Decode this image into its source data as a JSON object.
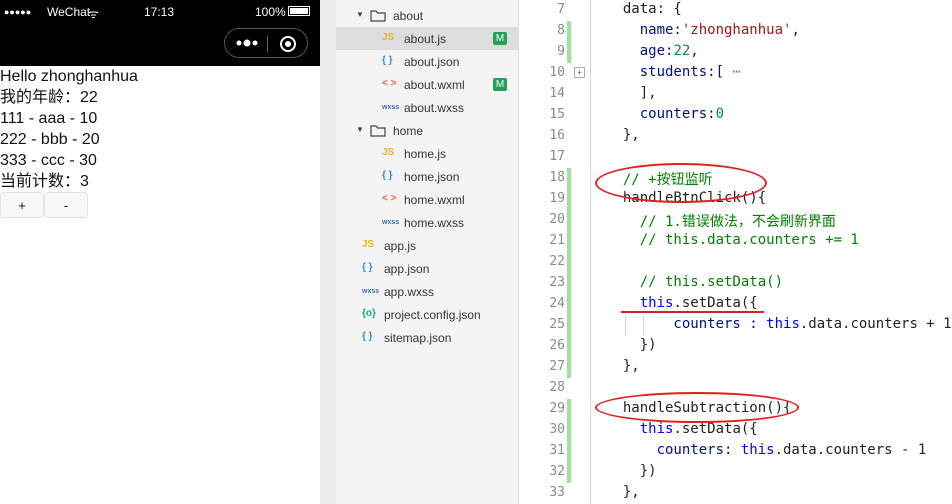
{
  "simulator": {
    "signal": "●●●●●",
    "carrier": "WeChat",
    "wifi": "ᯤ",
    "time": "17:13",
    "battery_pct": "100%",
    "lines": [
      "Hello zhonghanhua",
      "我的年龄：22",
      "111 - aaa - 10",
      "222 - bbb - 20",
      "333 - ccc - 30",
      "当前计数：3"
    ],
    "buttons": [
      "+",
      "-"
    ]
  },
  "file_tree": [
    {
      "name": "about",
      "type": "folder",
      "depth": 0
    },
    {
      "name": "about.js",
      "type": "js",
      "depth": 1,
      "selected": true,
      "badge": "M"
    },
    {
      "name": "about.json",
      "type": "json",
      "depth": 1
    },
    {
      "name": "about.wxml",
      "type": "wxml",
      "depth": 1,
      "badge": "M"
    },
    {
      "name": "about.wxss",
      "type": "wxss",
      "depth": 1
    },
    {
      "name": "home",
      "type": "folder",
      "depth": 0
    },
    {
      "name": "home.js",
      "type": "js",
      "depth": 1
    },
    {
      "name": "home.json",
      "type": "json",
      "depth": 1
    },
    {
      "name": "home.wxml",
      "type": "wxml",
      "depth": 1
    },
    {
      "name": "home.wxss",
      "type": "wxss",
      "depth": 1
    },
    {
      "name": "app.js",
      "type": "js",
      "depth": 0
    },
    {
      "name": "app.json",
      "type": "json",
      "depth": 0
    },
    {
      "name": "app.wxss",
      "type": "wxss",
      "depth": 0
    },
    {
      "name": "project.config.json",
      "type": "config",
      "depth": 0
    },
    {
      "name": "sitemap.json",
      "type": "json",
      "depth": 0
    }
  ],
  "icons": {
    "js": "JS",
    "json": "{ }",
    "wxml": "< >",
    "wxss": "wxss",
    "config": "{o}"
  },
  "icon_colors": {
    "js": "#e8b21c",
    "json": "#2f8fd8",
    "wxml": "#e8643c",
    "wxss": "#3a6fb0",
    "config": "#1aa38a"
  },
  "editor": {
    "lines": [
      {
        "n": "7",
        "segs": [
          [
            "  data: {",
            ""
          ]
        ]
      },
      {
        "n": "8",
        "segs": [
          [
            "    name:",
            "prop"
          ],
          [
            "'zhonghanhua'",
            "str"
          ],
          [
            ",",
            ""
          ]
        ]
      },
      {
        "n": "9",
        "segs": [
          [
            "    age:",
            "prop"
          ],
          [
            "22",
            "num"
          ],
          [
            ",",
            ""
          ]
        ]
      },
      {
        "n": "10",
        "segs": [
          [
            "    students:[",
            "prop"
          ],
          [
            " ⋯",
            "fold"
          ]
        ]
      },
      {
        "n": "14",
        "segs": [
          [
            "    ],",
            ""
          ]
        ]
      },
      {
        "n": "15",
        "segs": [
          [
            "    counters:",
            "prop"
          ],
          [
            "0",
            "num"
          ]
        ]
      },
      {
        "n": "16",
        "segs": [
          [
            "  },",
            ""
          ]
        ]
      },
      {
        "n": "17",
        "segs": []
      },
      {
        "n": "18",
        "segs": [
          [
            "  // +按钮监听",
            "com"
          ]
        ]
      },
      {
        "n": "19",
        "segs": [
          [
            "  handleBtnClick(){",
            ""
          ]
        ]
      },
      {
        "n": "20",
        "segs": [
          [
            "    // 1.错误做法，不会刷新界面",
            "com"
          ]
        ]
      },
      {
        "n": "21",
        "segs": [
          [
            "    // this.data.counters += 1",
            "com"
          ]
        ]
      },
      {
        "n": "22",
        "segs": []
      },
      {
        "n": "23",
        "segs": [
          [
            "    // this.setData()",
            "com"
          ]
        ]
      },
      {
        "n": "24",
        "segs": [
          [
            "    this",
            "kw"
          ],
          [
            ".setData({",
            ""
          ]
        ]
      },
      {
        "n": "25",
        "segs": [
          [
            "        counters : ",
            "prop"
          ],
          [
            "this",
            "kw"
          ],
          [
            ".data.counters + 1",
            ""
          ]
        ]
      },
      {
        "n": "26",
        "segs": [
          [
            "    })",
            ""
          ]
        ]
      },
      {
        "n": "27",
        "segs": [
          [
            "  },",
            ""
          ]
        ]
      },
      {
        "n": "28",
        "segs": []
      },
      {
        "n": "29",
        "segs": [
          [
            "  handleSubtraction(){",
            ""
          ]
        ]
      },
      {
        "n": "30",
        "segs": [
          [
            "    this",
            "kw"
          ],
          [
            ".setData({",
            ""
          ]
        ]
      },
      {
        "n": "31",
        "segs": [
          [
            "      counters: ",
            "prop"
          ],
          [
            "this",
            "kw"
          ],
          [
            ".data.counters - 1",
            ""
          ]
        ]
      },
      {
        "n": "32",
        "segs": [
          [
            "    })",
            ""
          ]
        ]
      },
      {
        "n": "33",
        "segs": [
          [
            "  },",
            ""
          ]
        ]
      }
    ]
  }
}
